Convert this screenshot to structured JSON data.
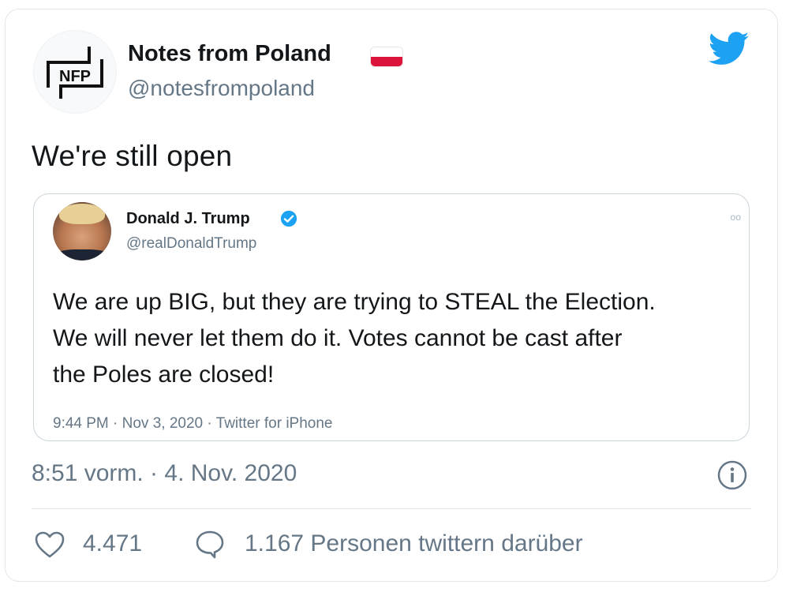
{
  "tweet": {
    "author": {
      "name": "Notes from Poland",
      "handle": "@notesfrompoland",
      "avatar_label": "NFP",
      "flag_colors": [
        "#ffffff",
        "#dc143c"
      ]
    },
    "text": "We're still open",
    "timestamp": "8:51 vorm. · 4. Nov. 2020",
    "stats": {
      "likes": "4.471",
      "replies_text": "1.167 Personen twittern darüber"
    },
    "icons": {
      "brand": "twitter-bird-icon",
      "info": "info-icon",
      "like": "heart-icon",
      "reply": "speech-bubble-icon"
    }
  },
  "quoted_tweet": {
    "author": {
      "name": "Donald J. Trump",
      "handle": "@realDonaldTrump",
      "verified": true
    },
    "text_lines": [
      "We are up BIG, but they are trying to STEAL the Election.",
      "We will never let them do it. Votes cannot be cast after",
      "the Poles are closed!"
    ],
    "meta": "9:44 PM · Nov 3, 2020 · Twitter for iPhone",
    "more": "oo"
  },
  "colors": {
    "twitter_blue": "#1da1f2",
    "text_primary": "#14171a",
    "text_secondary": "#657786",
    "border": "#e1e8ed"
  }
}
